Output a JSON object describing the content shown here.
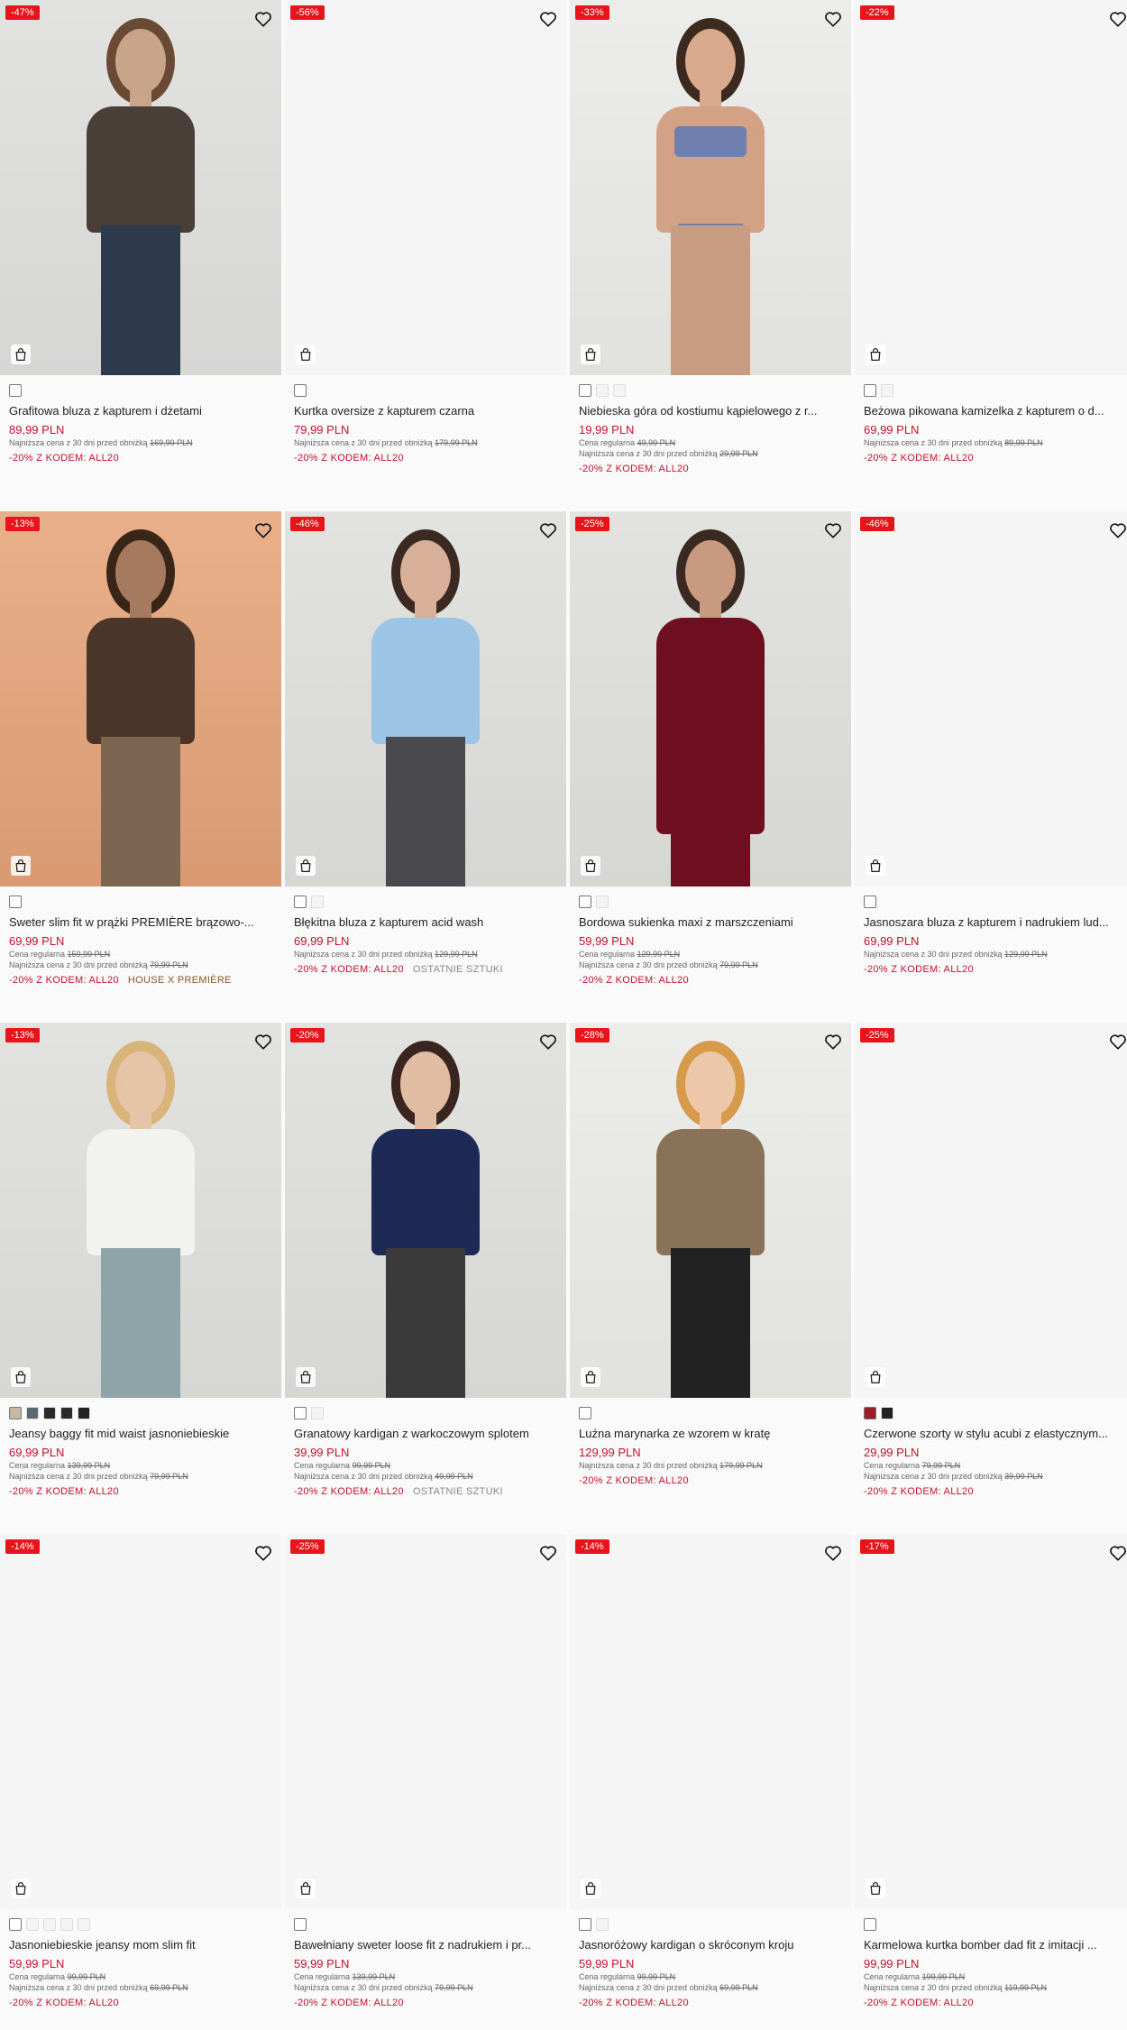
{
  "products": [
    {
      "badge": "-47%",
      "name": "Grafitowa bluza z kapturem i dżetami",
      "price": "89,99 PLN",
      "regular": "",
      "lowest_label": "Najniższa cena z 30 dni przed obniżką",
      "lowest": "169,99 PLN",
      "promo": "-20% Z KODEM: ALL20",
      "tag": "",
      "bg": "c-grey",
      "fig": "hoodie-brown"
    },
    {
      "badge": "-56%",
      "name": "Kurtka oversize z kapturem czarna",
      "price": "79,99 PLN",
      "regular": "",
      "lowest_label": "Najniższa cena z 30 dni przed obniżką",
      "lowest": "179,99 PLN",
      "promo": "-20% Z KODEM: ALL20",
      "tag": "",
      "bg": "",
      "fig": ""
    },
    {
      "badge": "-33%",
      "name": "Niebieska góra od kostiumu kąpielowego z r...",
      "price": "19,99 PLN",
      "regular_label": "Cena regularna",
      "regular": "49,99 PLN",
      "lowest_label": "Najniższa cena z 30 dni przed obniżką",
      "lowest": "29,99 PLN",
      "promo": "-20% Z KODEM: ALL20",
      "tag": "",
      "bg": "c-light",
      "fig": "bikini"
    },
    {
      "badge": "-22%",
      "name": "Beżowa pikowana kamizelka z kapturem o d...",
      "price": "69,99 PLN",
      "regular": "",
      "lowest_label": "Najniższa cena z 30 dni przed obniżką",
      "lowest": "89,99 PLN",
      "promo": "-20% Z KODEM: ALL20",
      "tag": "",
      "bg": "",
      "fig": ""
    },
    {
      "badge": "-13%",
      "name": "Sweter slim fit w prążki PREMIÈRE brązowo-...",
      "price": "69,99 PLN",
      "regular_label": "Cena regularna",
      "regular": "159,99 PLN",
      "lowest_label": "Najniższa cena z 30 dni przed obniżką",
      "lowest": "79,99 PLN",
      "promo": "-20% Z KODEM: ALL20",
      "tag": "HOUSE X PREMIÈRE",
      "bg": "c-peach",
      "fig": "sweater-brown"
    },
    {
      "badge": "-46%",
      "name": "Błękitna bluza z kapturem acid wash",
      "price": "69,99 PLN",
      "regular": "",
      "lowest_label": "Najniższa cena z 30 dni przed obniżką",
      "lowest": "129,99 PLN",
      "promo": "-20% Z KODEM: ALL20",
      "tag": "OSTATNIE SZTUKI",
      "bg": "c-grey",
      "fig": "hoodie-blue"
    },
    {
      "badge": "-25%",
      "name": "Bordowa sukienka maxi z marszczeniami",
      "price": "59,99 PLN",
      "regular_label": "Cena regularna",
      "regular": "129,99 PLN",
      "lowest_label": "Najniższa cena z 30 dni przed obniżką",
      "lowest": "79,99 PLN",
      "promo": "-20% Z KODEM: ALL20",
      "tag": "",
      "bg": "c-grey",
      "fig": "dress-red"
    },
    {
      "badge": "-46%",
      "name": "Jasnoszara bluza z kapturem i nadrukiem lud...",
      "price": "69,99 PLN",
      "regular": "",
      "lowest_label": "Najniższa cena z 30 dni przed obniżką",
      "lowest": "129,99 PLN",
      "promo": "-20% Z KODEM: ALL20",
      "tag": "",
      "bg": "",
      "fig": ""
    },
    {
      "badge": "-13%",
      "name": "Jeansy baggy fit mid waist jasnoniebieskie",
      "price": "69,99 PLN",
      "regular_label": "Cena regularna",
      "regular": "139,99 PLN",
      "lowest_label": "Najniższa cena z 30 dni przed obniżką",
      "lowest": "79,99 PLN",
      "promo": "-20% Z KODEM: ALL20",
      "tag": "",
      "bg": "c-grey",
      "fig": "jeans"
    },
    {
      "badge": "-20%",
      "name": "Granatowy kardigan z warkoczowym splotem",
      "price": "39,99 PLN",
      "regular_label": "Cena regularna",
      "regular": "99,99 PLN",
      "lowest_label": "Najniższa cena z 30 dni przed obniżką",
      "lowest": "49,99 PLN",
      "promo": "-20% Z KODEM: ALL20",
      "tag": "OSTATNIE SZTUKI",
      "bg": "c-grey",
      "fig": "cardigan-navy"
    },
    {
      "badge": "-28%",
      "name": "Luźna marynarka ze wzorem w kratę",
      "price": "129,99 PLN",
      "regular": "",
      "lowest_label": "Najniższa cena z 30 dni przed obniżką",
      "lowest": "179,99 PLN",
      "promo": "-20% Z KODEM: ALL20",
      "tag": "",
      "bg": "c-light",
      "fig": "blazer"
    },
    {
      "badge": "-25%",
      "name": "Czerwone szorty w stylu acubi z elastycznym...",
      "price": "29,99 PLN",
      "regular_label": "Cena regularna",
      "regular": "79,99 PLN",
      "lowest_label": "Najniższa cena z 30 dni przed obniżką",
      "lowest": "39,99 PLN",
      "promo": "-20% Z KODEM: ALL20",
      "tag": "",
      "bg": "",
      "fig": ""
    },
    {
      "badge": "-14%",
      "name": "Jasnoniebieskie jeansy mom slim fit",
      "price": "59,99 PLN",
      "regular_label": "Cena regularna",
      "regular": "99,99 PLN",
      "lowest_label": "Najniższa cena z 30 dni przed obniżką",
      "lowest": "69,99 PLN",
      "promo": "-20% Z KODEM: ALL20",
      "tag": "",
      "bg": "",
      "fig": ""
    },
    {
      "badge": "-25%",
      "name": "Bawełniany sweter loose fit z nadrukiem i pr...",
      "price": "59,99 PLN",
      "regular_label": "Cena regularna",
      "regular": "139,99 PLN",
      "lowest_label": "Najniższa cena z 30 dni przed obniżką",
      "lowest": "79,99 PLN",
      "promo": "-20% Z KODEM: ALL20",
      "tag": "",
      "bg": "",
      "fig": ""
    },
    {
      "badge": "-14%",
      "name": "Jasnoróżowy kardigan o skróconym kroju",
      "price": "59,99 PLN",
      "regular_label": "Cena regularna",
      "regular": "99,99 PLN",
      "lowest_label": "Najniższa cena z 30 dni przed obniżką",
      "lowest": "69,99 PLN",
      "promo": "-20% Z KODEM: ALL20",
      "tag": "",
      "bg": "",
      "fig": ""
    },
    {
      "badge": "-17%",
      "name": "Karmelowa kurtka bomber dad fit z imitacji ...",
      "price": "99,99 PLN",
      "regular_label": "Cena regularna",
      "regular": "199,99 PLN",
      "lowest_label": "Najniższa cena z 30 dni przed obniżką",
      "lowest": "119,99 PLN",
      "promo": "-20% Z KODEM: ALL20",
      "tag": "",
      "bg": "",
      "fig": ""
    }
  ],
  "swatches": [
    [
      "#ffffff"
    ],
    [
      "#ffffff"
    ],
    [
      "#ffffff",
      "#f4f4f4",
      "#f4f4f4"
    ],
    [
      "#ffffff",
      "#f4f4f4"
    ],
    [
      "#ffffff"
    ],
    [
      "#ffffff",
      "#f4f4f4"
    ],
    [
      "#ffffff",
      "#f4f4f4"
    ],
    [
      "#ffffff"
    ],
    [
      "#c9b8a0",
      "#5a6a70",
      "#2b2b2b",
      "#2b2b2b",
      "#222222"
    ],
    [
      "#ffffff",
      "#f4f4f4"
    ],
    [
      "#ffffff"
    ],
    [
      "#9c1b26",
      "#222222"
    ],
    [
      "#ffffff",
      "#f4f4f4",
      "#f4f4f4",
      "#f4f4f4",
      "#f4f4f4"
    ],
    [
      "#ffffff"
    ],
    [
      "#ffffff",
      "#f4f4f4"
    ],
    [
      "#ffffff"
    ]
  ],
  "icons": {
    "wishlist": "heart-icon",
    "cart": "shopping-bag-icon"
  }
}
